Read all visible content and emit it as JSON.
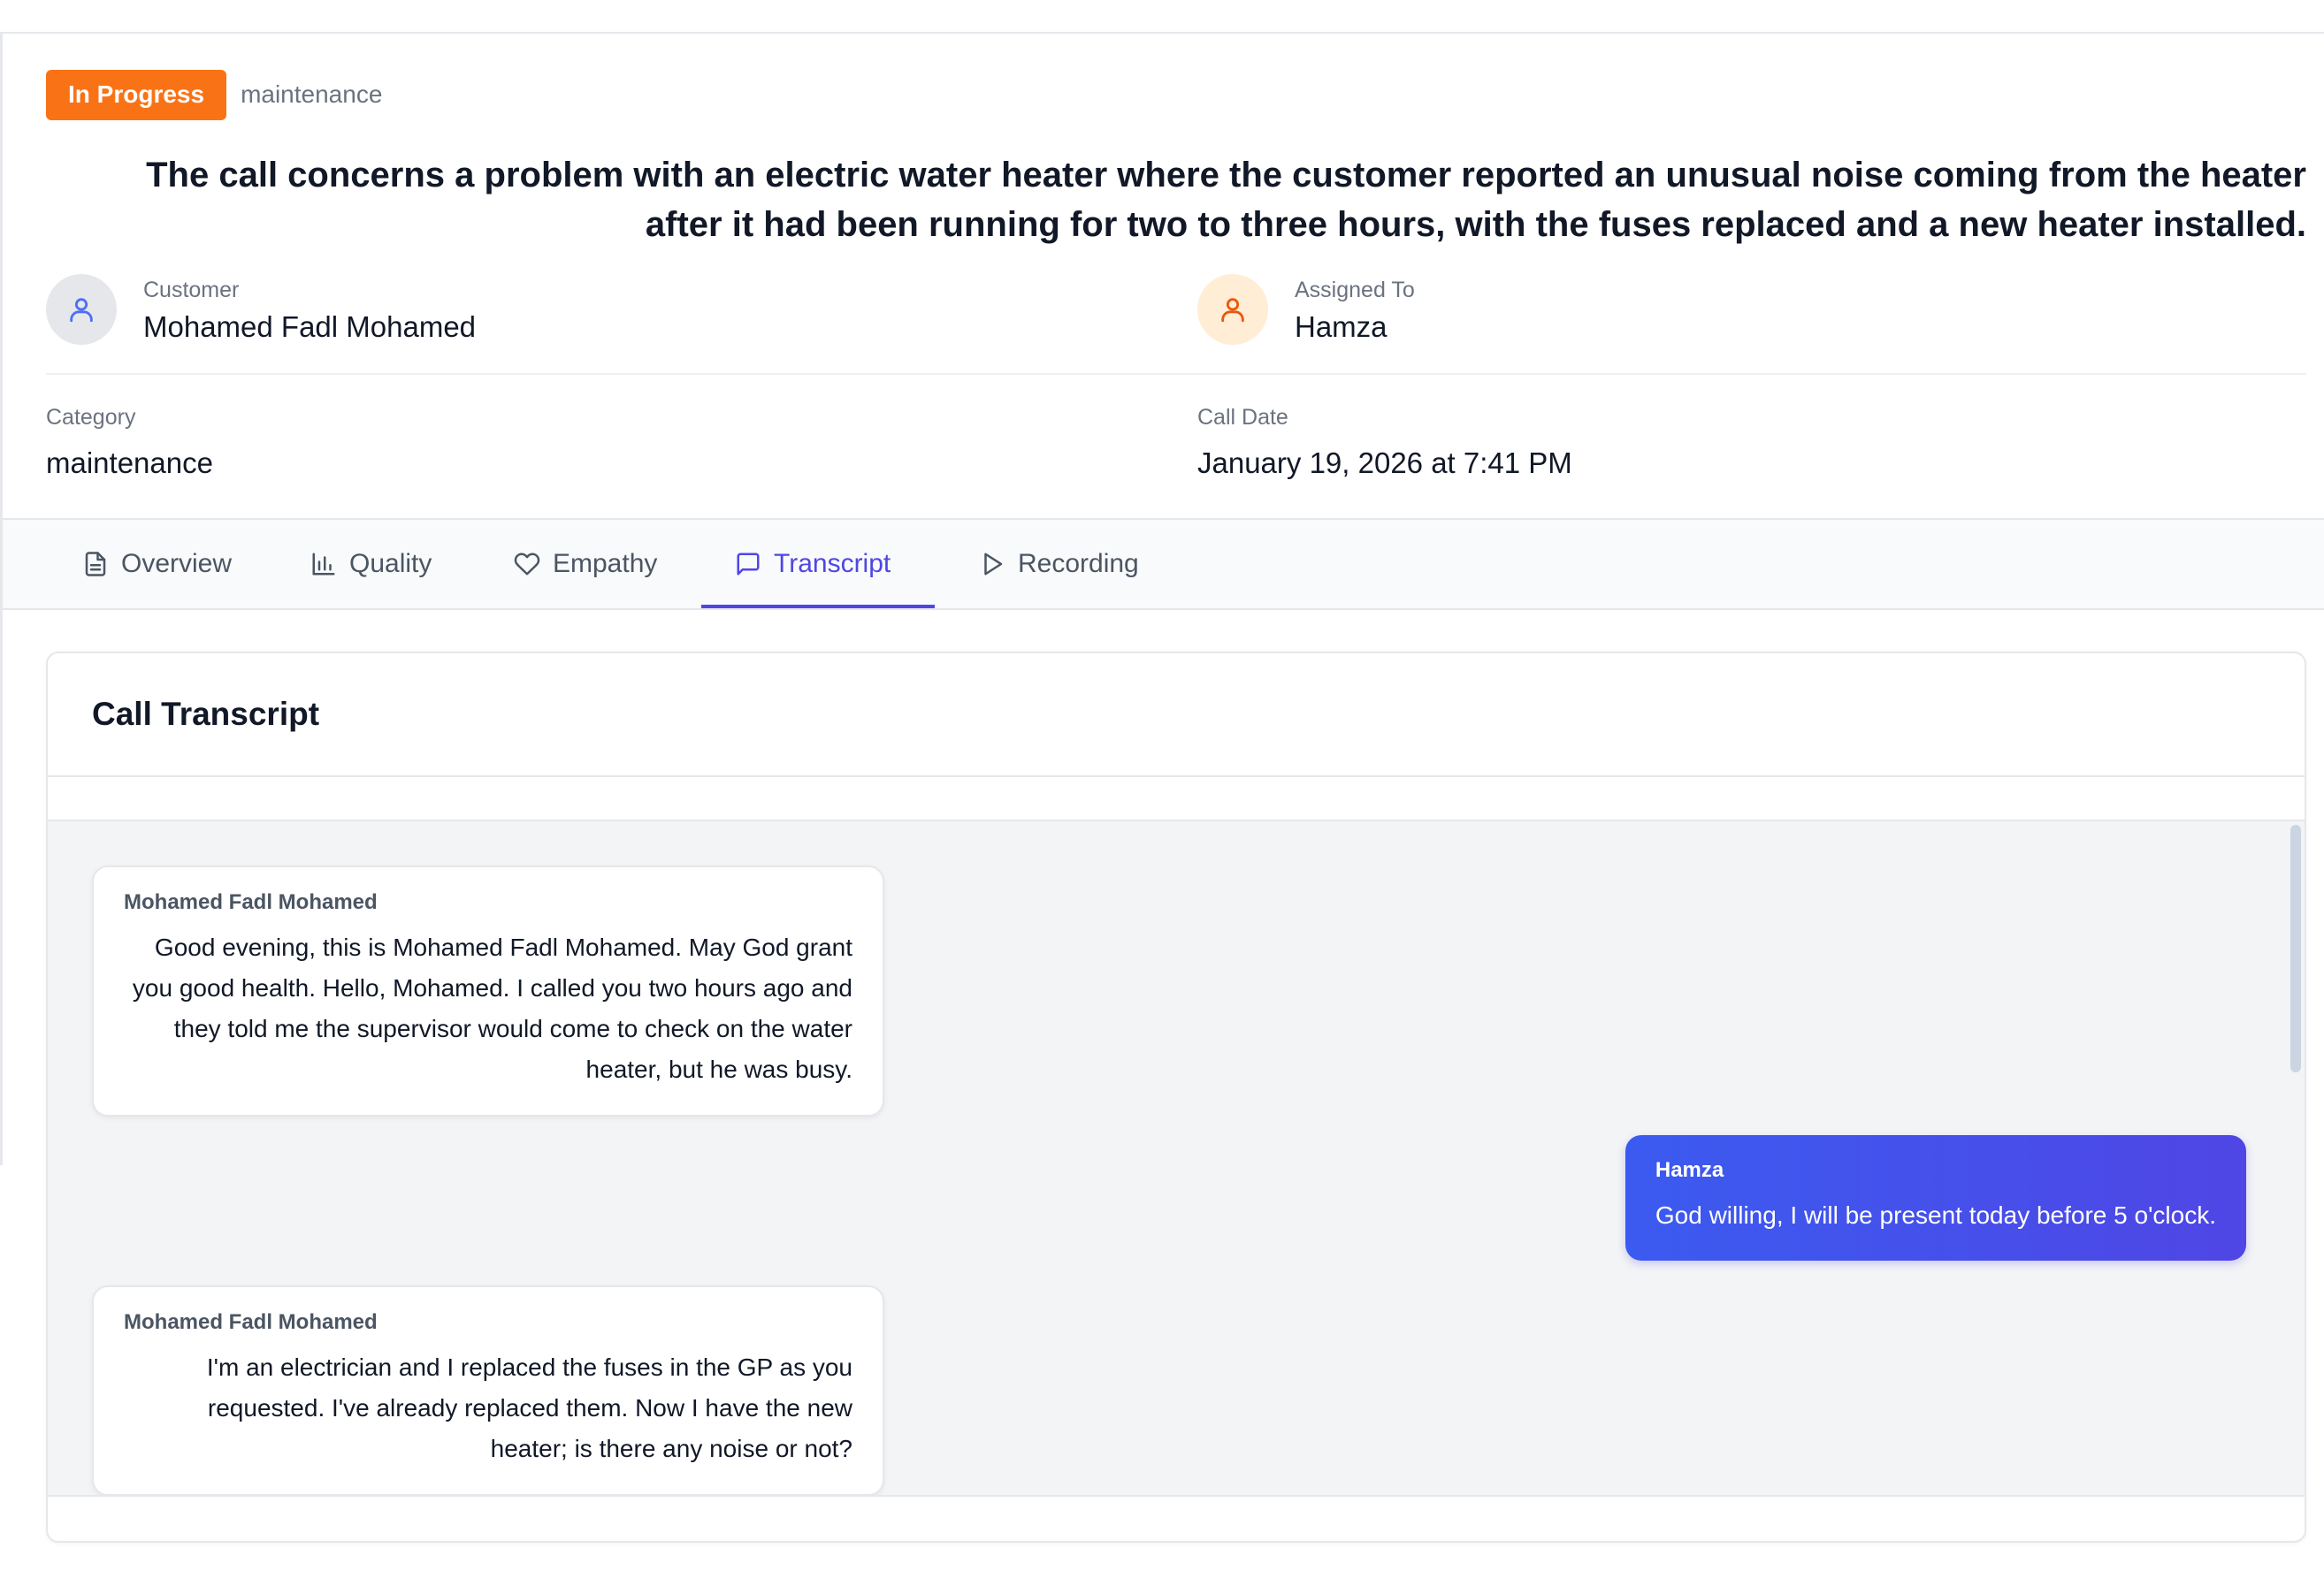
{
  "header": {
    "status": "In Progress",
    "category_tag": "maintenance",
    "summary": "The call concerns a problem with an electric water heater where the customer reported an unusual noise coming from the heater after it had been running for two to three hours, with the fuses replaced and a new heater installed."
  },
  "customer": {
    "label": "Customer",
    "name": "Mohamed Fadl Mohamed"
  },
  "assignee": {
    "label": "Assigned To",
    "name": "Hamza"
  },
  "details": {
    "category_label": "Category",
    "category_value": "maintenance",
    "date_label": "Call Date",
    "date_value": "January 19, 2026 at 7:41 PM"
  },
  "tabs": [
    {
      "label": "Overview",
      "icon": "document-icon"
    },
    {
      "label": "Quality",
      "icon": "bar-chart-icon"
    },
    {
      "label": "Empathy",
      "icon": "heart-icon"
    },
    {
      "label": "Transcript",
      "icon": "chat-icon",
      "active": true
    },
    {
      "label": "Recording",
      "icon": "play-icon"
    }
  ],
  "transcript": {
    "title": "Call Transcript",
    "messages": [
      {
        "speaker": "Mohamed Fadl Mohamed",
        "role": "customer",
        "text": "Good evening, this is Mohamed Fadl Mohamed. May God grant you good health. Hello, Mohamed. I called you two hours ago and they told me the supervisor would come to check on the water heater, but he was busy."
      },
      {
        "speaker": "Hamza",
        "role": "agent",
        "text": "God willing, I will be present today before 5 o'clock."
      },
      {
        "speaker": "Mohamed Fadl Mohamed",
        "role": "customer",
        "text": "I'm an electrician and I replaced the fuses in the GP as you requested. I've already replaced them. Now I have the new heater; is there any noise or not?"
      }
    ]
  },
  "colors": {
    "status_badge": "#f97316",
    "accent": "#4f46e5",
    "agent_bubble_start": "#3b5bf0"
  }
}
